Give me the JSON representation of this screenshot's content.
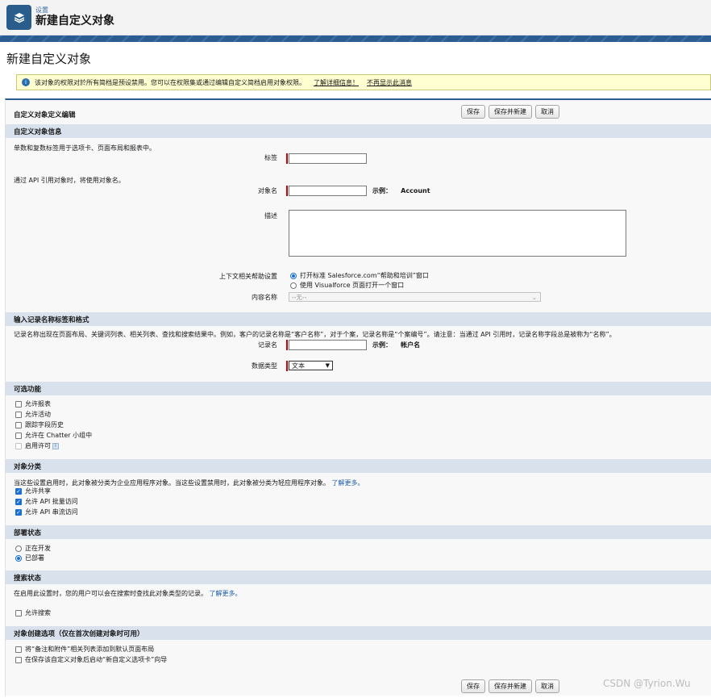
{
  "header": {
    "breadcrumb": "设置",
    "title": "新建自定义对象"
  },
  "page_title": "新建自定义对象",
  "notice": {
    "text": "该对象的权限对於所有简档是预设禁用。您可以在权限集或通过编辑自定义简档启用对象权限。",
    "link_learn": "了解详细信息！",
    "link_hide": "不再显示此消息"
  },
  "form": {
    "title": "自定义对象定义编辑",
    "buttons": {
      "save": "保存",
      "save_new": "保存并新建",
      "cancel": "取消"
    }
  },
  "section_info": {
    "title": "自定义对象信息",
    "intro": "单数和复数标签用于选项卡、页面布局和报表中。",
    "label_label": "标签",
    "api_note": "通过 API 引用对象时，将使用对象名。",
    "object_name_label": "对象名",
    "example_prefix": "示例：",
    "example_value": "Account",
    "description_label": "描述",
    "help_label": "上下文相关帮助设置",
    "help_option1": "打开标准 Salesforce.com“帮助和培训”窗口",
    "help_option2": "使用 Visualforce 页面打开一个窗口",
    "content_name_label": "内容名称",
    "content_name_value": "--无--"
  },
  "section_record": {
    "title": "输入记录名称标签和格式",
    "intro": "记录名称出现在页面布局、关键词列表、相关列表、查找和搜索结果中。例如，客户的记录名称是“客户名称”，对于个案，记录名称是“个案编号”。请注意：当通过 API 引用时，记录名称字段总是被称为“名称”。",
    "record_name_label": "记录名",
    "example_prefix": "示例：",
    "example_value": "帐户名",
    "data_type_label": "数据类型",
    "data_type_value": "文本"
  },
  "section_optional": {
    "title": "可选功能",
    "items": [
      "允许报表",
      "允许活动",
      "跟踪字段历史",
      "允许在 Chatter 小组中",
      "启用许可"
    ]
  },
  "section_classification": {
    "title": "对象分类",
    "intro": "当这些设置启用时，此对象被分类为企业应用程序对象。当这些设置禁用时，此对象被分类为轻应用程序对象。",
    "learn_more": "了解更多。",
    "items": [
      "允许共享",
      "允许 API 批量访问",
      "允许 API 串流访问"
    ]
  },
  "section_deploy": {
    "title": "部署状态",
    "options": [
      "正在开发",
      "已部署"
    ]
  },
  "section_search": {
    "title": "搜索状态",
    "intro": "在启用此设置时，您的用户可以会在搜索时查找此对象类型的记录。",
    "learn_more": "了解更多。",
    "allow_search": "允许搜索"
  },
  "section_create": {
    "title": "对象创建选项（仅在首次创建对象时可用）",
    "items": [
      "将“备注和附件”相关列表添加到默认页面布局",
      "在保存该自定义对象后启动“新自定义选项卡”向导"
    ]
  },
  "watermark": "CSDN @Tyrion.Wu"
}
